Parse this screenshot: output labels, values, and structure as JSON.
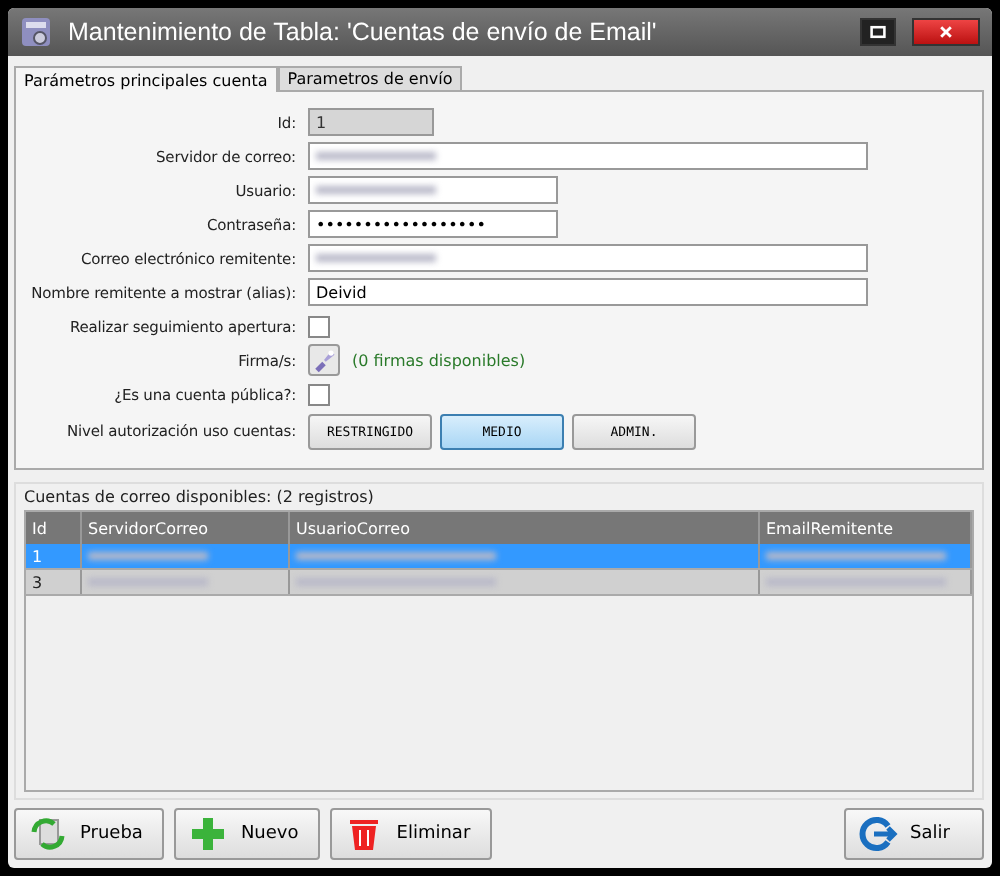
{
  "window": {
    "title": "Mantenimiento de Tabla: 'Cuentas de envío de Email'"
  },
  "tabs": [
    {
      "label": "Parámetros principales cuenta",
      "selected": true
    },
    {
      "label": "Parametros de envío",
      "selected": false
    }
  ],
  "form": [
    {
      "kind": "text",
      "label": "Id:",
      "value": "1",
      "disabled": true
    },
    {
      "kind": "blurred",
      "label": "Servidor de correo:"
    },
    {
      "kind": "blurred",
      "label": "Usuario:"
    },
    {
      "kind": "text",
      "label": "Contraseña:",
      "value": "••••••••••••••••••",
      "disabled": false
    },
    {
      "kind": "blurred",
      "label": "Correo electrónico remitente:"
    },
    {
      "kind": "text",
      "label": "Nombre remitente a mostrar (alias):",
      "value": "Deivid",
      "disabled": false
    },
    {
      "kind": "checkbox",
      "label": "Realizar seguimiento apertura:",
      "checked": false
    },
    {
      "kind": "signature",
      "label": "Firma/s:",
      "note": "(0 firmas disponibles)"
    },
    {
      "kind": "checkbox",
      "label": "¿Es una cuenta pública?:",
      "checked": false
    },
    {
      "kind": "levels",
      "label": "Nivel autorización uso cuentas:",
      "options": [
        {
          "label": "RESTRINGIDO",
          "selected": false
        },
        {
          "label": "MEDIO",
          "selected": true
        },
        {
          "label": "ADMIN.",
          "selected": false
        }
      ]
    }
  ],
  "accounts": {
    "title": "Cuentas de correo disponibles:  (2 registros)",
    "columns": [
      "Id",
      "ServidorCorreo",
      "UsuarioCorreo",
      "EmailRemitente"
    ],
    "rows": [
      {
        "id": "1",
        "selected": true
      },
      {
        "id": "3",
        "selected": false
      }
    ]
  },
  "buttons": [
    {
      "label": "Prueba"
    },
    {
      "label": "Nuevo"
    },
    {
      "label": "Eliminar"
    },
    {
      "label": "Salir"
    }
  ]
}
